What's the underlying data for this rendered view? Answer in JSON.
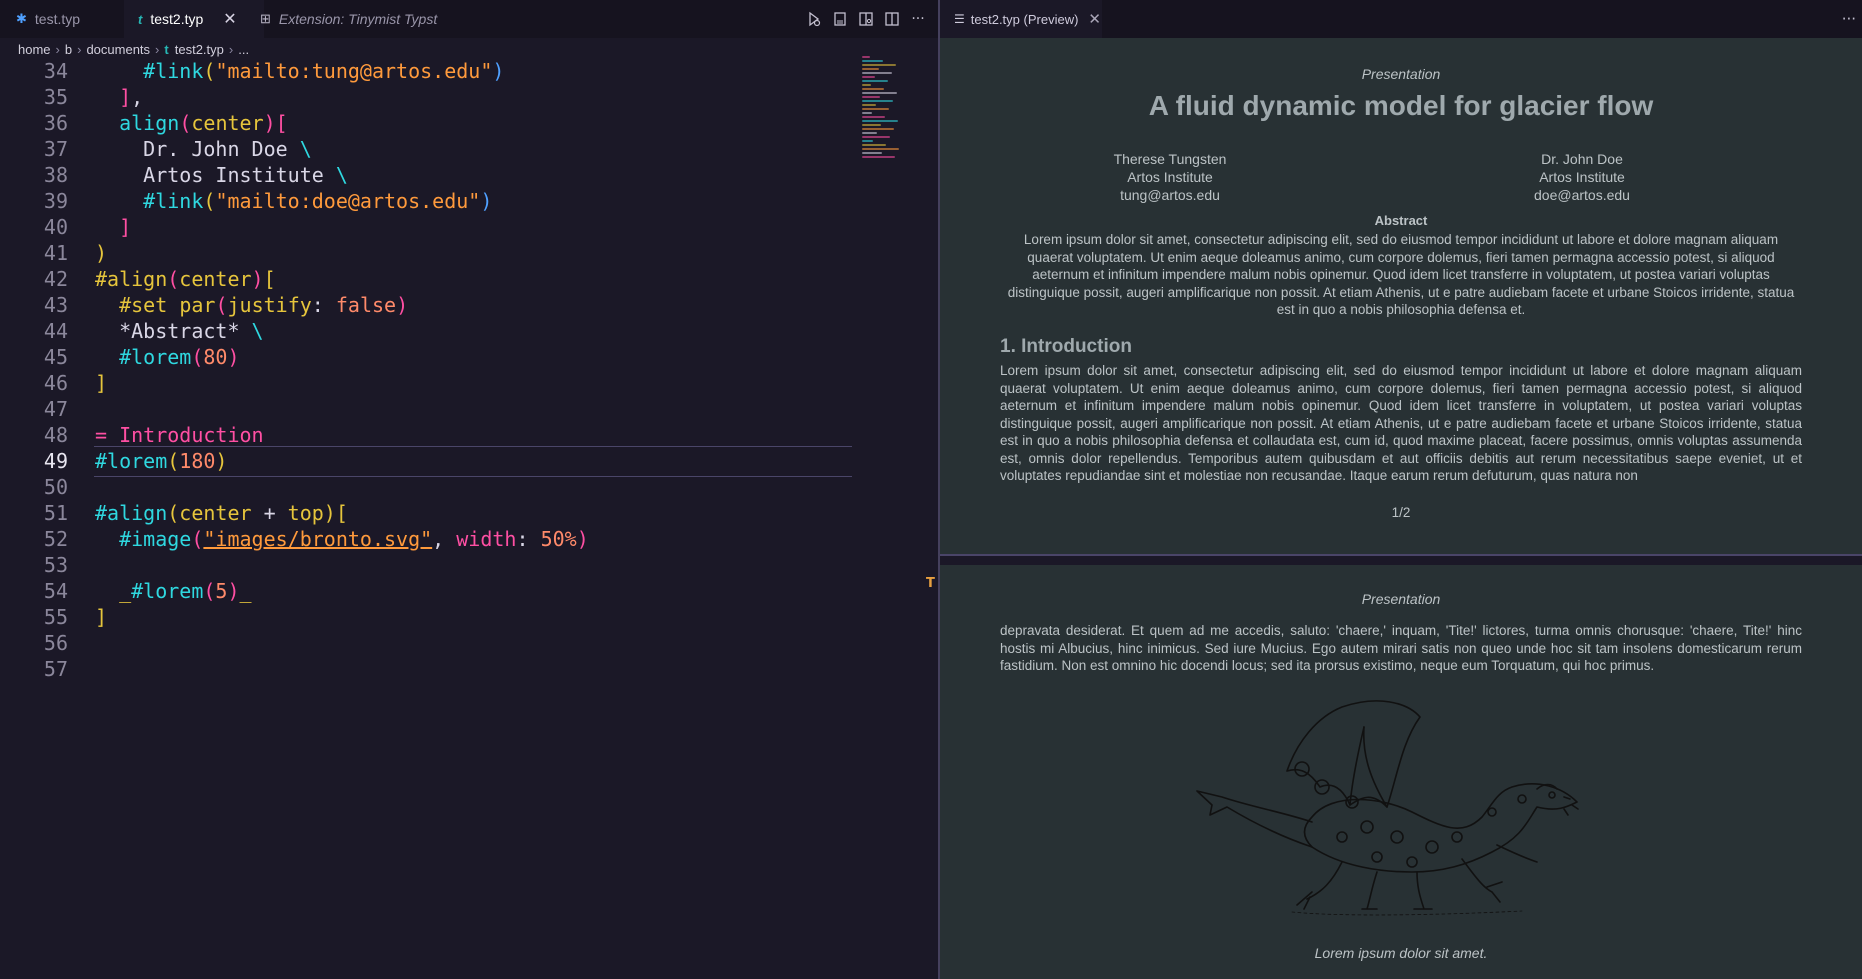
{
  "tabs": [
    {
      "label": "test.typ",
      "icon": "typst-file-icon"
    },
    {
      "label": "test2.typ",
      "icon": "typst-t-icon",
      "active": true
    },
    {
      "label": "Extension: Tinymist Typst",
      "icon": "extension-icon"
    }
  ],
  "breadcrumb": [
    "home",
    "b",
    "documents",
    "test2.typ",
    "..."
  ],
  "editor": {
    "lines": [
      {
        "n": "34",
        "segs": [
          [
            "    ",
            "#d9d6e6"
          ],
          [
            "#link",
            "#2fd8e0"
          ],
          [
            "(",
            "#e6c53c"
          ],
          [
            "\"mailto:tung@artos.edu\"",
            "#ff9a3c"
          ],
          [
            ")",
            "#4fa0ff"
          ]
        ]
      },
      {
        "n": "35",
        "segs": [
          [
            "  ",
            "#d9d6e6"
          ],
          [
            "]",
            "#ff4fa3"
          ],
          [
            ",",
            "#d9d6e6"
          ]
        ]
      },
      {
        "n": "36",
        "segs": [
          [
            "  ",
            "#d9d6e6"
          ],
          [
            "align",
            "#2fd8e0"
          ],
          [
            "(",
            "#ff4fa3"
          ],
          [
            "center",
            "#e6c53c"
          ],
          [
            ")",
            "#ff4fa3"
          ],
          [
            "[",
            "#ff4fa3"
          ]
        ]
      },
      {
        "n": "37",
        "segs": [
          [
            "    Dr. John Doe ",
            "#d9d6e6"
          ],
          [
            "\\",
            "#2fd8e0"
          ]
        ]
      },
      {
        "n": "38",
        "segs": [
          [
            "    Artos Institute ",
            "#d9d6e6"
          ],
          [
            "\\",
            "#2fd8e0"
          ]
        ]
      },
      {
        "n": "39",
        "segs": [
          [
            "    ",
            "#d9d6e6"
          ],
          [
            "#link",
            "#2fd8e0"
          ],
          [
            "(",
            "#e6c53c"
          ],
          [
            "\"mailto:doe@artos.edu\"",
            "#ff9a3c"
          ],
          [
            ")",
            "#4fa0ff"
          ]
        ]
      },
      {
        "n": "40",
        "segs": [
          [
            "  ",
            "#d9d6e6"
          ],
          [
            "]",
            "#ff4fa3"
          ]
        ]
      },
      {
        "n": "41",
        "segs": [
          [
            ")",
            "#e6c53c"
          ]
        ]
      },
      {
        "n": "42",
        "segs": [
          [
            "#align",
            "#e6c53c"
          ],
          [
            "(",
            "#ff4fa3"
          ],
          [
            "center",
            "#e6c53c"
          ],
          [
            ")",
            "#ff4fa3"
          ],
          [
            "[",
            "#e6c53c"
          ]
        ]
      },
      {
        "n": "43",
        "segs": [
          [
            "  ",
            "#d9d6e6"
          ],
          [
            "#set",
            "#e6c53c"
          ],
          [
            " ",
            "#d9d6e6"
          ],
          [
            "par",
            "#e6c53c"
          ],
          [
            "(",
            "#ff4fa3"
          ],
          [
            "justify",
            "#e6c53c"
          ],
          [
            ": ",
            "#d9d6e6"
          ],
          [
            "false",
            "#ff8a6a"
          ],
          [
            ")",
            "#ff4fa3"
          ]
        ]
      },
      {
        "n": "44",
        "segs": [
          [
            "  *Abstract* ",
            "#d9d6e6"
          ],
          [
            "\\",
            "#2fd8e0"
          ]
        ]
      },
      {
        "n": "45",
        "segs": [
          [
            "  ",
            "#d9d6e6"
          ],
          [
            "#lorem",
            "#2fd8e0"
          ],
          [
            "(",
            "#ff4fa3"
          ],
          [
            "80",
            "#ff8a6a"
          ],
          [
            ")",
            "#ff4fa3"
          ]
        ]
      },
      {
        "n": "46",
        "segs": [
          [
            "]",
            "#e6c53c"
          ]
        ]
      },
      {
        "n": "47",
        "segs": []
      },
      {
        "n": "48",
        "segs": [
          [
            "= Introduction",
            "#ff4fa3"
          ]
        ]
      },
      {
        "n": "49",
        "segs": [
          [
            "#lorem",
            "#2fd8e0"
          ],
          [
            "(",
            "#e6c53c"
          ],
          [
            "180",
            "#ff8a6a"
          ],
          [
            ")",
            "#e6c53c"
          ]
        ],
        "current": true
      },
      {
        "n": "50",
        "segs": []
      },
      {
        "n": "51",
        "segs": [
          [
            "#align",
            "#2fd8e0"
          ],
          [
            "(",
            "#e6c53c"
          ],
          [
            "center",
            "#e6c53c"
          ],
          [
            " + ",
            "#d9d6e6"
          ],
          [
            "top",
            "#e6c53c"
          ],
          [
            ")",
            "#e6c53c"
          ],
          [
            "[",
            "#e6c53c"
          ]
        ]
      },
      {
        "n": "52",
        "segs": [
          [
            "  ",
            "#d9d6e6"
          ],
          [
            "#image",
            "#2fd8e0"
          ],
          [
            "(",
            "#ff4fa3"
          ],
          [
            "\"images/bronto.svg\"",
            "#ff9a3c"
          ],
          [
            ", ",
            "#d9d6e6"
          ],
          [
            "width",
            "#ff4fa3"
          ],
          [
            ": ",
            "#d9d6e6"
          ],
          [
            "50%",
            "#ff8a6a"
          ],
          [
            ")",
            "#ff4fa3"
          ]
        ]
      },
      {
        "n": "53",
        "segs": []
      },
      {
        "n": "54",
        "segs": [
          [
            "  _",
            "#e6c53c"
          ],
          [
            "#lorem",
            "#2fd8e0"
          ],
          [
            "(",
            "#ff4fa3"
          ],
          [
            "5",
            "#ff8a6a"
          ],
          [
            ")",
            "#ff4fa3"
          ],
          [
            "_",
            "#e6c53c"
          ]
        ]
      },
      {
        "n": "55",
        "segs": [
          [
            "]",
            "#e6c53c"
          ]
        ]
      },
      {
        "n": "56",
        "segs": []
      },
      {
        "n": "57",
        "segs": []
      }
    ]
  },
  "preview": {
    "tab_label": "test2.typ (Preview)",
    "header": "Presentation",
    "title": "A fluid dynamic model for glacier flow",
    "authors": [
      {
        "name": "Therese Tungsten",
        "inst": "Artos Institute",
        "email": "tung@artos.edu"
      },
      {
        "name": "Dr. John Doe",
        "inst": "Artos Institute",
        "email": "doe@artos.edu"
      }
    ],
    "abstract_title": "Abstract",
    "abstract": "Lorem ipsum dolor sit amet, consectetur adipiscing elit, sed do eiusmod tempor incididunt ut labore et dolore magnam aliquam quaerat voluptatem. Ut enim aeque doleamus animo, cum corpore dolemus, fieri tamen permagna accessio potest, si aliquod aeternum et infinitum impendere malum nobis opinemur. Quod idem licet transferre in voluptatem, ut postea variari voluptas distinguique possit, augeri amplificarique non possit. At etiam Athenis, ut e patre audiebam facete et urbane Stoicos irridente, statua est in quo a nobis philosophia defensa et.",
    "section": "1. Introduction",
    "intro": "Lorem ipsum dolor sit amet, consectetur adipiscing elit, sed do eiusmod tempor incididunt ut labore et dolore magnam aliquam quaerat voluptatem. Ut enim aeque doleamus animo, cum corpore dolemus, fieri tamen permagna accessio potest, si aliquod aeternum et infinitum impendere malum nobis opinemur. Quod idem licet transferre in voluptatem, ut postea variari voluptas distinguique possit, augeri amplificarique non possit. At etiam Athenis, ut e patre audiebam facete et urbane Stoicos irridente, statua est in quo a nobis philosophia defensa et collaudata est, cum id, quod maxime placeat, facere possimus, omnis voluptas assumenda est, omnis dolor repellendus. Temporibus autem quibusdam et aut officiis debitis aut rerum necessitatibus saepe eveniet, ut et voluptates repudiandae sint et molestiae non recusandae. Itaque earum rerum defuturum, quas natura non",
    "page_number": "1/2",
    "page2_text": "depravata desiderat. Et quem ad me accedis, saluto: 'chaere,' inquam, 'Tite!' lictores, turma omnis chorusque: 'chaere, Tite!' hinc hostis mi Albucius, hinc inimicus. Sed iure Mucius. Ego autem mirari satis non queo unde hoc sit tam insolens domesticarum rerum fastidium. Non est omnino hic docendi locus; sed ita prorsus existimo, neque eum Torquatum, qui hoc primus.",
    "caption": "Lorem ipsum dolor sit amet."
  }
}
